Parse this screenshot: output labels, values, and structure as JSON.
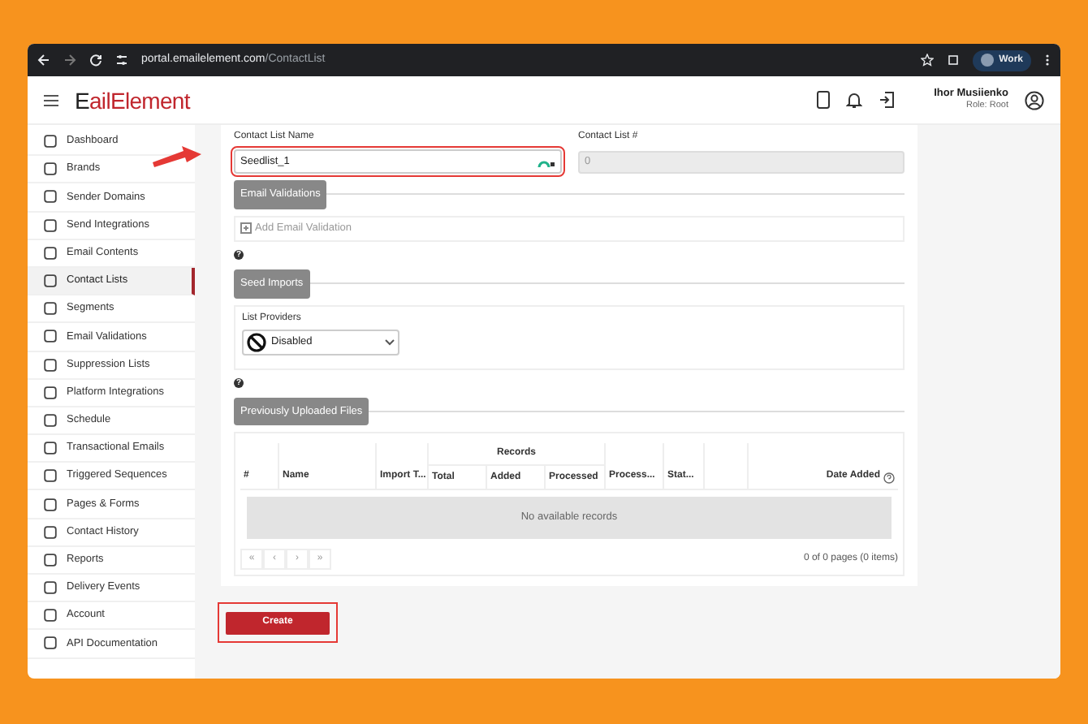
{
  "browser": {
    "url_host": "portal.emailelement.com",
    "url_path": "/ContactList",
    "profile": "Work"
  },
  "header": {
    "logo_first": "E",
    "logo_mid": "ail",
    "logo_last": "Element",
    "user_name": "Ihor Musiienko",
    "user_role": "Role: Root"
  },
  "sidebar": {
    "items": [
      {
        "label": "Dashboard",
        "selected": false
      },
      {
        "label": "Brands",
        "selected": false
      },
      {
        "label": "Sender Domains",
        "selected": false
      },
      {
        "label": "Send Integrations",
        "selected": false
      },
      {
        "label": "Email Contents",
        "selected": false
      },
      {
        "label": "Contact Lists",
        "selected": true
      },
      {
        "label": "Segments",
        "selected": false
      },
      {
        "label": "Email Validations",
        "selected": false
      },
      {
        "label": "Suppression Lists",
        "selected": false
      },
      {
        "label": "Platform Integrations",
        "selected": false
      },
      {
        "label": "Schedule",
        "selected": false
      },
      {
        "label": "Transactional Emails",
        "selected": false
      },
      {
        "label": "Triggered Sequences",
        "selected": false
      },
      {
        "label": "Pages & Forms",
        "selected": false
      },
      {
        "label": "Contact History",
        "selected": false
      },
      {
        "label": "Reports",
        "selected": false
      },
      {
        "label": "Delivery Events",
        "selected": false
      },
      {
        "label": "Account",
        "selected": false
      },
      {
        "label": "API Documentation",
        "selected": false
      }
    ]
  },
  "form": {
    "name_label": "Contact List Name",
    "name_value": "Seedlist_1",
    "number_label": "Contact List #",
    "number_value": "0"
  },
  "email_validations": {
    "heading": "Email Validations",
    "add_label": "Add Email Validation",
    "help": "?"
  },
  "seed_imports": {
    "heading": "Seed Imports",
    "providers_label": "List Providers",
    "providers_value": "Disabled",
    "help": "?"
  },
  "files": {
    "heading": "Previously Uploaded Files",
    "group_header": "Records",
    "columns": [
      "#",
      "Name",
      "Import T...",
      "Total",
      "Added",
      "Processed",
      "Process...",
      "Stat...",
      "Date Added"
    ],
    "empty": "No available records",
    "pager": [
      "«",
      "‹",
      "›",
      "»"
    ],
    "page_info": "0 of 0 pages (0 items)"
  },
  "create_button": "Create"
}
